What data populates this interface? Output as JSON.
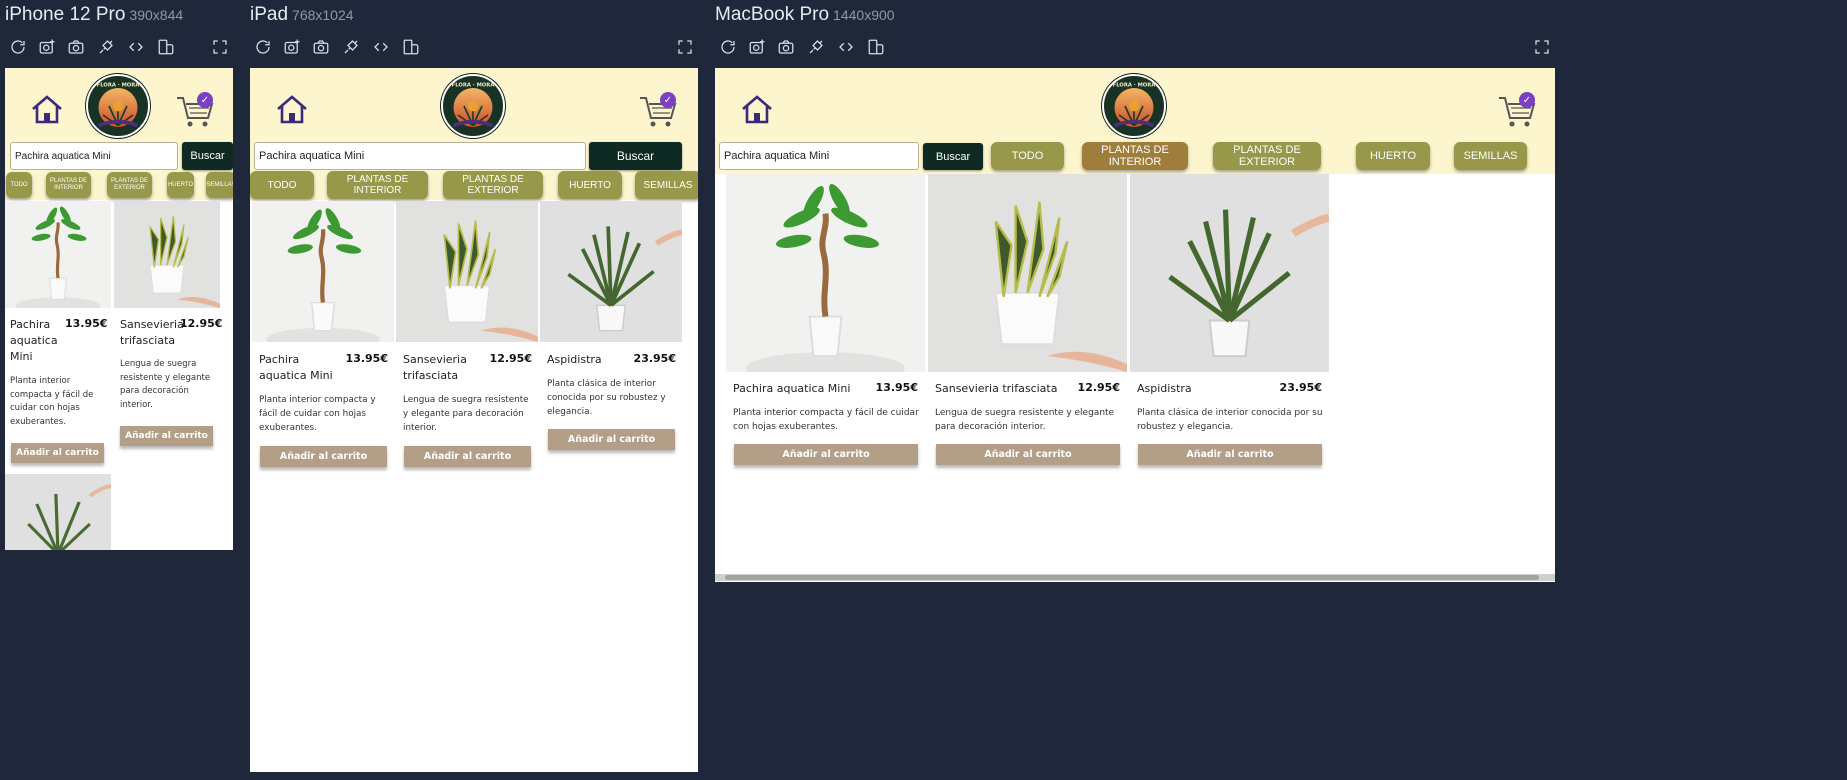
{
  "toolbar_icons": [
    "refresh-icon",
    "camera-settings-icon",
    "camera-icon",
    "plug-icon",
    "code-icon",
    "rotate-device-icon",
    "fullscreen-icon"
  ],
  "search": {
    "value": "Pachira aquatica Mini",
    "button_label": "Buscar"
  },
  "logo_text": "FLORA · MORA",
  "categories": [
    "TODO",
    "PLANTAS DE INTERIOR",
    "PLANTAS DE EXTERIOR",
    "HUERTO",
    "SEMILLAS"
  ],
  "active_category_desktop": "PLANTAS DE INTERIOR",
  "products": [
    {
      "name": "Pachira aquatica Mini",
      "price": "13.95€",
      "description": "Planta interior compacta y fácil de cuidar con hojas exuberantes.",
      "cta": "Añadir al carrito",
      "image": "pachira-plant"
    },
    {
      "name": "Sansevieria trifasciata",
      "price": "12.95€",
      "description": "Lengua de suegra resistente y elegante para decoración interior.",
      "cta": "Añadir al carrito",
      "image": "sansevieria-plant"
    },
    {
      "name": "Aspidistra",
      "price": "23.95€",
      "description": "Planta clásica de interior conocida por su robustez y elegancia.",
      "cta": "Añadir al carrito",
      "image": "aspidistra-plant"
    }
  ],
  "devices": [
    {
      "name": "iPhone 12 Pro",
      "size": "390x844"
    },
    {
      "name": "iPad",
      "size": "768x1024"
    },
    {
      "name": "MacBook Pro",
      "size": "1440x900"
    }
  ],
  "colors": {
    "header_bg": "#fdf5cd",
    "category_bg": "#97984a",
    "category_active_bg": "#9f7d3a",
    "search_button_bg": "#0e2a22",
    "add_button_bg": "#b39f87",
    "app_bg": "#1e283a",
    "cart_badge": "#7b3fc4"
  }
}
